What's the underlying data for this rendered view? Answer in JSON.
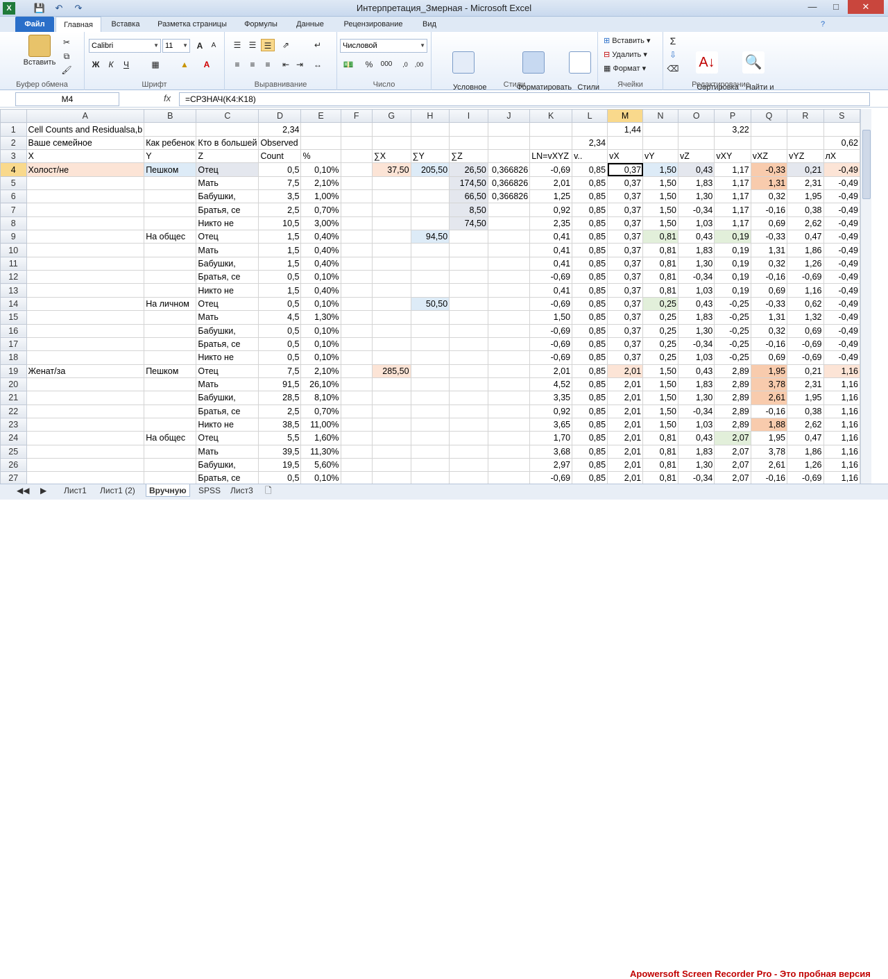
{
  "window": {
    "title": "Интерпретация_Змерная - Microsoft Excel"
  },
  "tabs": [
    "Файл",
    "Главная",
    "Вставка",
    "Разметка страницы",
    "Формулы",
    "Данные",
    "Рецензирование",
    "Вид"
  ],
  "ribbon": {
    "clipboard": {
      "label": "Буфер обмена",
      "paste": "Вставить"
    },
    "font": {
      "label": "Шрифт",
      "name": "Calibri",
      "size": "11",
      "bold": "Ж",
      "italic": "К",
      "underline": "Ч"
    },
    "align": {
      "label": "Выравнивание"
    },
    "number": {
      "label": "Число",
      "format": "Числовой",
      "pct": "%",
      "thousand": "000"
    },
    "styles": {
      "label": "Стили",
      "cond": "Условное\nформатирование",
      "table": "Форматировать\nкак таблицу",
      "cell": "Стили\nячеек"
    },
    "cells": {
      "label": "Ячейки",
      "insert": "Вставить",
      "delete": "Удалить",
      "format": "Формат"
    },
    "edit": {
      "label": "Редактирование",
      "sort": "Сортировка\nи фильтр",
      "find": "Найти и\nвыделить"
    }
  },
  "formula_bar": {
    "name_box": "M4",
    "fx": "fx",
    "formula": "=СРЗНАЧ(K4:K18)"
  },
  "columns": [
    "A",
    "B",
    "C",
    "D",
    "E",
    "F",
    "G",
    "H",
    "I",
    "J",
    "K",
    "L",
    "M",
    "N",
    "O",
    "P",
    "Q",
    "R",
    "S"
  ],
  "rows": [
    {
      "n": "1",
      "c": [
        "Cell Counts and Residualsa,b",
        "",
        "",
        "2,34",
        "",
        "",
        "",
        "",
        "",
        "",
        "",
        "",
        "1,44",
        "",
        "",
        "3,22",
        "",
        "",
        ""
      ]
    },
    {
      "n": "2",
      "c": [
        "Ваше семейное",
        "Как ребенок",
        "Кто в большей",
        "Observed",
        "",
        "",
        "",
        "",
        "",
        "",
        "",
        "2,34",
        "",
        "",
        "",
        "",
        "",
        "",
        "0,62"
      ]
    },
    {
      "n": "3",
      "c": [
        "X",
        "Y",
        "Z",
        "Count",
        "%",
        "",
        "∑X",
        "∑Y",
        "∑Z",
        "",
        "LN=vXYZ",
        "v..",
        "vX",
        "vY",
        "vZ",
        "vXY",
        "vXZ",
        "vYZ",
        "лX"
      ]
    },
    {
      "n": "4",
      "c": [
        "Холост/не",
        "Пешком",
        "Отец",
        "0,5",
        "0,10%",
        "",
        "37,50",
        "205,50",
        "26,50",
        "0,366826",
        "-0,69",
        "0,85",
        "0,37",
        "1,50",
        "0,43",
        "1,17",
        "-0,33",
        "0,21",
        "-0,49"
      ]
    },
    {
      "n": "5",
      "c": [
        "",
        "",
        "Мать",
        "7,5",
        "2,10%",
        "",
        "",
        "",
        "174,50",
        "0,366826",
        "2,01",
        "0,85",
        "0,37",
        "1,50",
        "1,83",
        "1,17",
        "1,31",
        "2,31",
        "-0,49"
      ]
    },
    {
      "n": "6",
      "c": [
        "",
        "",
        "Бабушки,",
        "3,5",
        "1,00%",
        "",
        "",
        "",
        "66,50",
        "0,366826",
        "1,25",
        "0,85",
        "0,37",
        "1,50",
        "1,30",
        "1,17",
        "0,32",
        "1,95",
        "-0,49"
      ]
    },
    {
      "n": "7",
      "c": [
        "",
        "",
        "Братья, се",
        "2,5",
        "0,70%",
        "",
        "",
        "",
        "8,50",
        "",
        "0,92",
        "0,85",
        "0,37",
        "1,50",
        "-0,34",
        "1,17",
        "-0,16",
        "0,38",
        "-0,49"
      ]
    },
    {
      "n": "8",
      "c": [
        "",
        "",
        "Никто не",
        "10,5",
        "3,00%",
        "",
        "",
        "",
        "74,50",
        "",
        "2,35",
        "0,85",
        "0,37",
        "1,50",
        "1,03",
        "1,17",
        "0,69",
        "2,62",
        "-0,49"
      ]
    },
    {
      "n": "9",
      "c": [
        "",
        "На общес",
        "Отец",
        "1,5",
        "0,40%",
        "",
        "",
        "94,50",
        "",
        "",
        "0,41",
        "0,85",
        "0,37",
        "0,81",
        "0,43",
        "0,19",
        "-0,33",
        "0,47",
        "-0,49"
      ]
    },
    {
      "n": "10",
      "c": [
        "",
        "",
        "Мать",
        "1,5",
        "0,40%",
        "",
        "",
        "",
        "",
        "",
        "0,41",
        "0,85",
        "0,37",
        "0,81",
        "1,83",
        "0,19",
        "1,31",
        "1,86",
        "-0,49"
      ]
    },
    {
      "n": "11",
      "c": [
        "",
        "",
        "Бабушки,",
        "1,5",
        "0,40%",
        "",
        "",
        "",
        "",
        "",
        "0,41",
        "0,85",
        "0,37",
        "0,81",
        "1,30",
        "0,19",
        "0,32",
        "1,26",
        "-0,49"
      ]
    },
    {
      "n": "12",
      "c": [
        "",
        "",
        "Братья, се",
        "0,5",
        "0,10%",
        "",
        "",
        "",
        "",
        "",
        "-0,69",
        "0,85",
        "0,37",
        "0,81",
        "-0,34",
        "0,19",
        "-0,16",
        "-0,69",
        "-0,49"
      ]
    },
    {
      "n": "13",
      "c": [
        "",
        "",
        "Никто не",
        "1,5",
        "0,40%",
        "",
        "",
        "",
        "",
        "",
        "0,41",
        "0,85",
        "0,37",
        "0,81",
        "1,03",
        "0,19",
        "0,69",
        "1,16",
        "-0,49"
      ]
    },
    {
      "n": "14",
      "c": [
        "",
        "На личном",
        "Отец",
        "0,5",
        "0,10%",
        "",
        "",
        "50,50",
        "",
        "",
        "-0,69",
        "0,85",
        "0,37",
        "0,25",
        "0,43",
        "-0,25",
        "-0,33",
        "0,62",
        "-0,49"
      ]
    },
    {
      "n": "15",
      "c": [
        "",
        "",
        "Мать",
        "4,5",
        "1,30%",
        "",
        "",
        "",
        "",
        "",
        "1,50",
        "0,85",
        "0,37",
        "0,25",
        "1,83",
        "-0,25",
        "1,31",
        "1,32",
        "-0,49"
      ]
    },
    {
      "n": "16",
      "c": [
        "",
        "",
        "Бабушки,",
        "0,5",
        "0,10%",
        "",
        "",
        "",
        "",
        "",
        "-0,69",
        "0,85",
        "0,37",
        "0,25",
        "1,30",
        "-0,25",
        "0,32",
        "0,69",
        "-0,49"
      ]
    },
    {
      "n": "17",
      "c": [
        "",
        "",
        "Братья, се",
        "0,5",
        "0,10%",
        "",
        "",
        "",
        "",
        "",
        "-0,69",
        "0,85",
        "0,37",
        "0,25",
        "-0,34",
        "-0,25",
        "-0,16",
        "-0,69",
        "-0,49"
      ]
    },
    {
      "n": "18",
      "c": [
        "",
        "",
        "Никто не",
        "0,5",
        "0,10%",
        "",
        "",
        "",
        "",
        "",
        "-0,69",
        "0,85",
        "0,37",
        "0,25",
        "1,03",
        "-0,25",
        "0,69",
        "-0,69",
        "-0,49"
      ]
    },
    {
      "n": "19",
      "c": [
        "Женат/за",
        "Пешком",
        "Отец",
        "7,5",
        "2,10%",
        "",
        "285,50",
        "",
        "",
        "",
        "2,01",
        "0,85",
        "2,01",
        "1,50",
        "0,43",
        "2,89",
        "1,95",
        "0,21",
        "1,16"
      ]
    },
    {
      "n": "20",
      "c": [
        "",
        "",
        "Мать",
        "91,5",
        "26,10%",
        "",
        "",
        "",
        "",
        "",
        "4,52",
        "0,85",
        "2,01",
        "1,50",
        "1,83",
        "2,89",
        "3,78",
        "2,31",
        "1,16"
      ]
    },
    {
      "n": "21",
      "c": [
        "",
        "",
        "Бабушки,",
        "28,5",
        "8,10%",
        "",
        "",
        "",
        "",
        "",
        "3,35",
        "0,85",
        "2,01",
        "1,50",
        "1,30",
        "2,89",
        "2,61",
        "1,95",
        "1,16"
      ]
    },
    {
      "n": "22",
      "c": [
        "",
        "",
        "Братья, се",
        "2,5",
        "0,70%",
        "",
        "",
        "",
        "",
        "",
        "0,92",
        "0,85",
        "2,01",
        "1,50",
        "-0,34",
        "2,89",
        "-0,16",
        "0,38",
        "1,16"
      ]
    },
    {
      "n": "23",
      "c": [
        "",
        "",
        "Никто не",
        "38,5",
        "11,00%",
        "",
        "",
        "",
        "",
        "",
        "3,65",
        "0,85",
        "2,01",
        "1,50",
        "1,03",
        "2,89",
        "1,88",
        "2,62",
        "1,16"
      ]
    },
    {
      "n": "24",
      "c": [
        "",
        "На общес",
        "Отец",
        "5,5",
        "1,60%",
        "",
        "",
        "",
        "",
        "",
        "1,70",
        "0,85",
        "2,01",
        "0,81",
        "0,43",
        "2,07",
        "1,95",
        "0,47",
        "1,16"
      ]
    },
    {
      "n": "25",
      "c": [
        "",
        "",
        "Мать",
        "39,5",
        "11,30%",
        "",
        "",
        "",
        "",
        "",
        "3,68",
        "0,85",
        "2,01",
        "0,81",
        "1,83",
        "2,07",
        "3,78",
        "1,86",
        "1,16"
      ]
    },
    {
      "n": "26",
      "c": [
        "",
        "",
        "Бабушки,",
        "19,5",
        "5,60%",
        "",
        "",
        "",
        "",
        "",
        "2,97",
        "0,85",
        "2,01",
        "0,81",
        "1,30",
        "2,07",
        "2,61",
        "1,26",
        "1,16"
      ]
    },
    {
      "n": "27",
      "c": [
        "",
        "",
        "Братья, се",
        "0,5",
        "0,10%",
        "",
        "",
        "",
        "",
        "",
        "-0,69",
        "0,85",
        "2,01",
        "0,81",
        "-0,34",
        "2,07",
        "-0,16",
        "-0,69",
        "1,16"
      ]
    }
  ],
  "sheets": [
    "Лист1",
    "Лист1 (2)",
    "Вручную",
    "SPSS",
    "Лист3"
  ],
  "active_sheet": "Вручную",
  "active_cell": "M4",
  "watermark": "Apowersoft Screen Recorder Pro - Это пробная версия"
}
